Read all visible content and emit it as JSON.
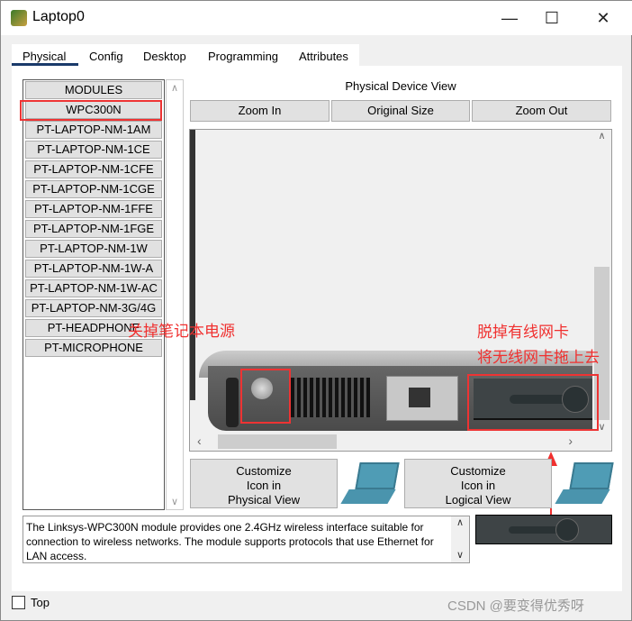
{
  "window": {
    "title": "Laptop0",
    "minimize": "—",
    "maximize": "☐",
    "close": "✕"
  },
  "tabs": [
    "Physical",
    "Config",
    "Desktop",
    "Programming",
    "Attributes"
  ],
  "modules": {
    "header": "MODULES",
    "items": [
      "WPC300N",
      "PT-LAPTOP-NM-1AM",
      "PT-LAPTOP-NM-1CE",
      "PT-LAPTOP-NM-1CFE",
      "PT-LAPTOP-NM-1CGE",
      "PT-LAPTOP-NM-1FFE",
      "PT-LAPTOP-NM-1FGE",
      "PT-LAPTOP-NM-1W",
      "PT-LAPTOP-NM-1W-A",
      "PT-LAPTOP-NM-1W-AC",
      "PT-LAPTOP-NM-3G/4G",
      "PT-HEADPHONE",
      "PT-MICROPHONE"
    ]
  },
  "view": {
    "title": "Physical Device View",
    "zoom_in": "Zoom In",
    "original_size": "Original Size",
    "zoom_out": "Zoom Out"
  },
  "customize": {
    "physical": "Customize Icon in Physical View",
    "logical": "Customize Icon in Logical View"
  },
  "description": "The Linksys-WPC300N module provides one 2.4GHz wireless interface suitable for connection to wireless networks. The module supports protocols that use Ethernet for LAN access.",
  "annotations": {
    "power": "关掉笔记本电源",
    "remove": "脱掉有线网卡",
    "drag": "将无线网卡拖上去"
  },
  "top_checkbox": {
    "label": "Top",
    "checked": false
  },
  "watermark": "CSDN @要变得优秀呀",
  "colors": {
    "annotation": "#f0302f",
    "tab_underline": "#1a3a6a"
  }
}
